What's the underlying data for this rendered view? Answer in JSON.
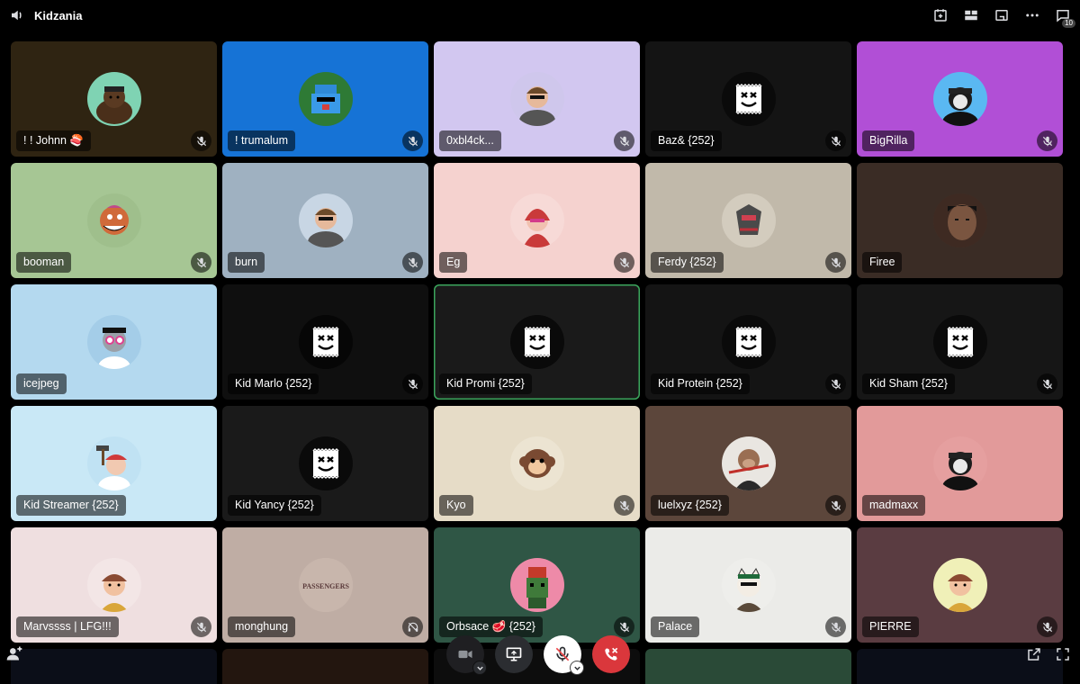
{
  "header": {
    "channel_title": "Kidzania",
    "notification_count": "10"
  },
  "icons": {
    "speaker": "speaker-icon",
    "schedule": "calendar-add-icon",
    "layout": "grid-layout-icon",
    "popout": "popout-window-icon",
    "more": "more-dots-icon",
    "chat": "chat-icon",
    "add_user": "add-user-icon",
    "fullscreen": "fullscreen-icon"
  },
  "colors": {
    "speaking_border": "#3ba55c",
    "leave_red": "#da373c",
    "mute_red": "#ed4245"
  },
  "participants": [
    {
      "name": "! ! Johnn 🍣",
      "bg": "#2f2412",
      "avatar_bg": "#7fd3b3",
      "avatar": "bear",
      "muted": true
    },
    {
      "name": "! trumalum",
      "bg": "#1673d6",
      "avatar_bg": "#2e7a35",
      "avatar": "pixel",
      "muted": true
    },
    {
      "name": "0xbl4ck...",
      "bg": "#d2c7f0",
      "avatar_bg": "#cfc7ec",
      "avatar": "person",
      "muted": true
    },
    {
      "name": "Baz& {252}",
      "bg": "#141414",
      "avatar_bg": "#0a0a0a",
      "avatar": "stamp",
      "muted": true
    },
    {
      "name": "BigRilla",
      "bg": "#b14fd6",
      "avatar_bg": "#5ab8f2",
      "avatar": "person-dark",
      "muted": true
    },
    {
      "name": "booman",
      "bg": "#a6c694",
      "avatar_bg": "#9fbf8c",
      "avatar": "zombie",
      "muted": true
    },
    {
      "name": "burn",
      "bg": "#9fb1c1",
      "avatar_bg": "#c8d6e4",
      "avatar": "person",
      "muted": true
    },
    {
      "name": "Eg",
      "bg": "#f5d2cf",
      "avatar_bg": "#f7dad7",
      "avatar": "person-red",
      "muted": true
    },
    {
      "name": "Ferdy {252}",
      "bg": "#c1b9aa",
      "avatar_bg": "#d3ccbe",
      "avatar": "mech",
      "muted": true
    },
    {
      "name": "Firee",
      "bg": "#3a2c25",
      "avatar_bg": "#4a382e",
      "avatar": "photo",
      "muted": false
    },
    {
      "name": "icejpeg",
      "bg": "#b4d9ef",
      "avatar_bg": "#a4cde8",
      "avatar": "skull",
      "muted": false
    },
    {
      "name": "Kid Marlo {252}",
      "bg": "#0f0f0f",
      "avatar_bg": "#060606",
      "avatar": "stamp",
      "muted": true
    },
    {
      "name": "Kid Promi {252}",
      "bg": "#1a1a1a",
      "avatar_bg": "#0a0a0a",
      "avatar": "stamp",
      "muted": false,
      "speaking": true
    },
    {
      "name": "Kid Protein {252}",
      "bg": "#141414",
      "avatar_bg": "#0a0a0a",
      "avatar": "stamp",
      "muted": true
    },
    {
      "name": "Kid Sham {252}",
      "bg": "#161616",
      "avatar_bg": "#0a0a0a",
      "avatar": "stamp",
      "muted": true
    },
    {
      "name": "Kid Streamer {252}",
      "bg": "#c9e8f6",
      "avatar_bg": "#c0e2f3",
      "avatar": "hammer",
      "muted": false
    },
    {
      "name": "Kid Yancy {252}",
      "bg": "#1a1a1a",
      "avatar_bg": "#0a0a0a",
      "avatar": "stamp",
      "muted": false
    },
    {
      "name": "Kyo",
      "bg": "#e6dcc7",
      "avatar_bg": "#ece4d2",
      "avatar": "monkey",
      "muted": true
    },
    {
      "name": "luelxyz {252}",
      "bg": "#5c463b",
      "avatar_bg": "#e9e6e1",
      "avatar": "monkey-brown",
      "muted": true
    },
    {
      "name": "madmaxx",
      "bg": "#e29a9a",
      "avatar_bg": "#e59f9f",
      "avatar": "person-dark",
      "muted": false
    },
    {
      "name": "Marvssss | LFG!!!",
      "bg": "#efdfe0",
      "avatar_bg": "#f3e6e6",
      "avatar": "kid",
      "muted": true
    },
    {
      "name": "monghung",
      "bg": "#bfada4",
      "avatar_bg": "#c8b6ac",
      "avatar": "passengers",
      "muted": false,
      "deafened": true
    },
    {
      "name": "Orbsace 🥩 {252}",
      "bg": "#2f5645",
      "avatar_bg": "#ee8aa8",
      "avatar": "pixel-green",
      "muted": true
    },
    {
      "name": "Palace",
      "bg": "#ebebe8",
      "avatar_bg": "#eeeeeb",
      "avatar": "cat",
      "muted": true
    },
    {
      "name": "PIERRE",
      "bg": "#5a3c41",
      "avatar_bg": "#f0f0b8",
      "avatar": "kid",
      "muted": true
    }
  ],
  "partial_row_colors": [
    "#0b0e18",
    "#23160f",
    "#0d0d0d",
    "#2a4a37",
    "#0b0e18"
  ],
  "passengers_text": "PASSENGERS"
}
